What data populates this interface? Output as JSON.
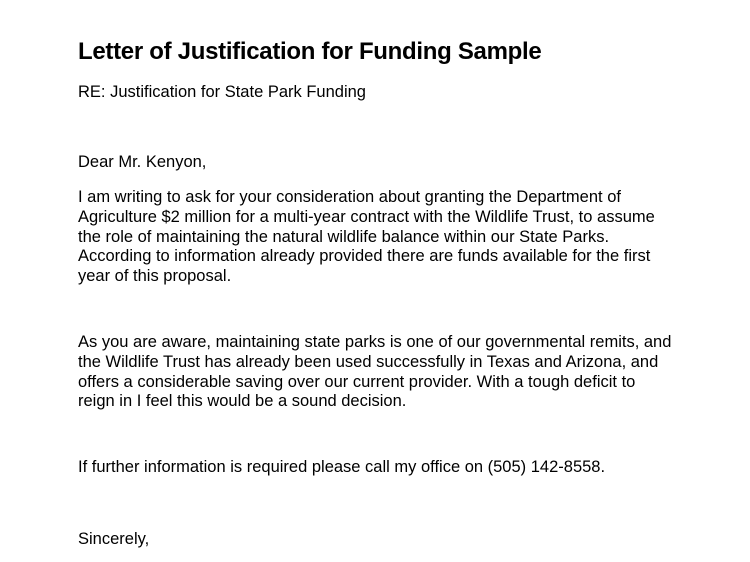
{
  "document": {
    "title": "Letter of Justification for Funding Sample",
    "re_line": "RE: Justification for State Park Funding",
    "salutation": "Dear Mr. Kenyon,",
    "paragraphs": [
      {
        "lines": [
          "I am writing to ask for your consideration about granting the Department of",
          "Agriculture $2 million for a multi-year contract with the Wildlife Trust, to assume",
          "the role of maintaining the natural wildlife balance within our State Parks.",
          "According to information already provided there are funds available for the first",
          "year of this proposal."
        ]
      },
      {
        "lines": [
          "As you are aware, maintaining state parks is one of our governmental remits, and",
          "the Wildlife Trust has already been used successfully in Texas and Arizona, and",
          "offers a considerable saving over our current provider. With a tough deficit to",
          "reign in I feel this would be a sound decision."
        ]
      },
      {
        "lines": [
          "If further information is required please call my office on (505) 142-8558."
        ]
      }
    ],
    "closing": "Sincerely,"
  }
}
